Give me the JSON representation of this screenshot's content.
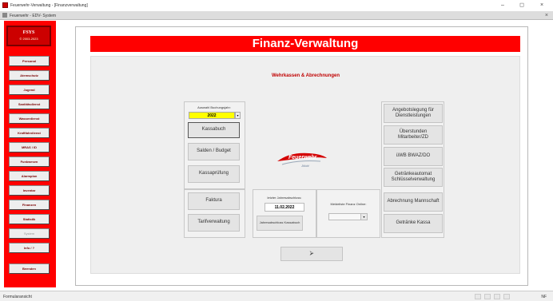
{
  "window": {
    "title": "Feuerwehr-Verwaltung - [Finanzverwaltung]",
    "minimize": "–",
    "maximize": "◻",
    "close": "×"
  },
  "tab": {
    "label": "Feuerwehr - EDV- System",
    "close": "×"
  },
  "logo": {
    "name": "FSYS",
    "years": "© 2003-2023"
  },
  "sidebar": {
    "items": [
      {
        "label": "Personal"
      },
      {
        "label": "Atemschutz"
      },
      {
        "label": "Jugend"
      },
      {
        "label": "Sanitätsdienst"
      },
      {
        "label": "Wasserdienst"
      },
      {
        "label": "Kraftfahrdienst"
      },
      {
        "label": "MRAS / ID"
      },
      {
        "label": "Funkwesen"
      },
      {
        "label": "Alarmplan"
      },
      {
        "label": "Inventar"
      },
      {
        "label": "Finanzen"
      },
      {
        "label": "Statistik"
      },
      {
        "label": "System"
      },
      {
        "label": "Info / ?"
      },
      {
        "label": "Beenden"
      }
    ]
  },
  "header": {
    "title": "Finanz-Verwaltung"
  },
  "subtitle": "Wehrkassen & Abrechnungen",
  "buchungsjahr": {
    "label": "Auswahl Buchungsjahr:",
    "value": "2022"
  },
  "left_buttons": {
    "kassabuch": "Kassabuch",
    "salden": "Salden / Budget",
    "kassapruefung": "Kassaprüfung",
    "faktura": "Faktura",
    "tarif": "Tarifverwaltung"
  },
  "fw_logo": {
    "text": "Feuerwehr",
    "sub": "Jöbbl"
  },
  "jahresabschluss": {
    "label": "letzter Jahresabschluss:",
    "date": "11.02.2022",
    "button": "Jahresabschluss Kassabuch"
  },
  "meldeliste": {
    "label": "Meldeliste Finanz Online:"
  },
  "right_buttons": {
    "angebot": "Angebotslegung für Dienstleistungen",
    "ueberstunden": "Überstunden Mitarbeiter/ZD",
    "uwb": "üWB BWAZ/DO",
    "getraenkeautomat": "Getränkeautomat Schlüsselverwaltung",
    "abrechnung": "Abrechnung Mannschaft",
    "getraenke": "Getränke Kassa"
  },
  "bottom_nav": {
    "icon": "exit-icon",
    "glyph": "⮚"
  },
  "status": {
    "text": "Formularansicht",
    "nf": "NF"
  },
  "colors": {
    "brand_red": "#ff0000",
    "year_yellow": "#ffff00",
    "subtitle_red": "#c00000"
  }
}
